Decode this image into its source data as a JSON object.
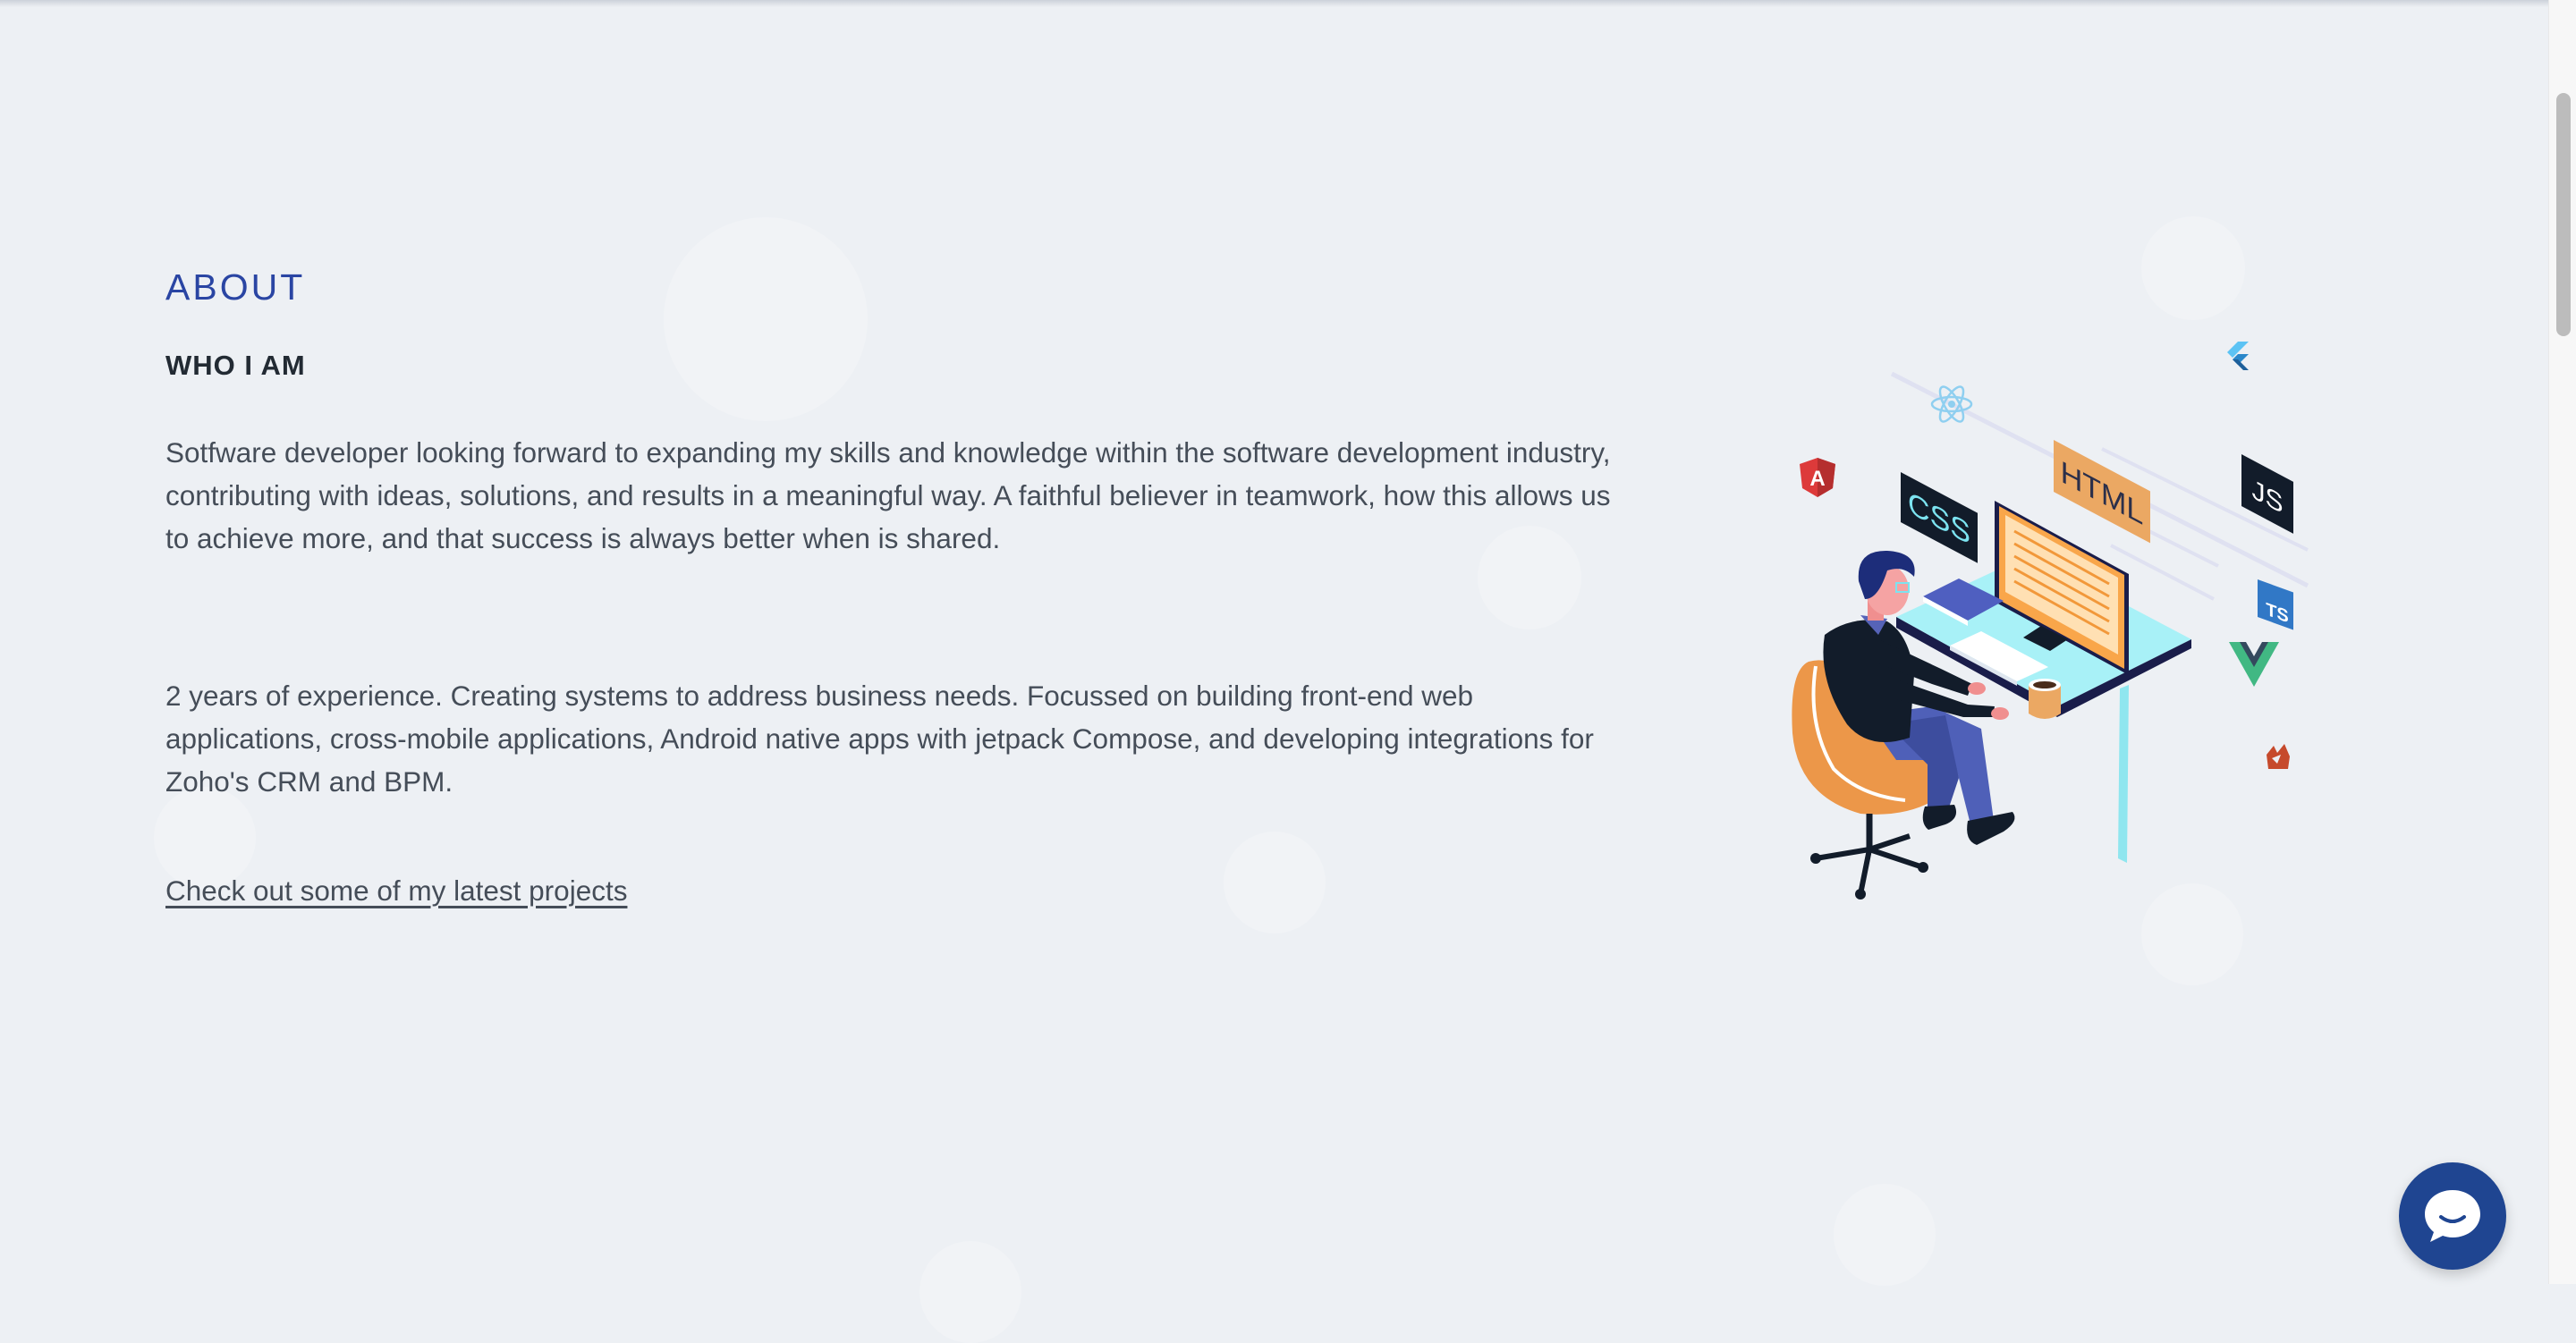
{
  "about": {
    "eyebrow": "ABOUT",
    "subtitle": "WHO I AM",
    "paragraph_1": "Sotfware developer looking forward to expanding my skills and knowledge within the software development industry, contributing with ideas, solutions, and results in a meaningful way. A faithful believer in teamwork, how this allows us to achieve more, and that success is always better when is shared.",
    "paragraph_2": "2 years of experience. Creating systems to address business needs. Focussed on building front-end web applications, cross-mobile applications, Android native apps with jetpack Compose, and developing integrations for Zoho's CRM and BPM.",
    "projects_link": "Check out some of my latest projects"
  },
  "illustration": {
    "labels": {
      "html": "HTML",
      "css": "CSS",
      "js": "JS",
      "ts": "TS",
      "angular": "A"
    },
    "icons": [
      "react-icon",
      "flutter-icon",
      "angular-icon",
      "javascript-icon",
      "typescript-icon",
      "vue-icon",
      "svelte-icon"
    ]
  },
  "chat": {
    "icon": "chat-bubble-icon"
  },
  "colors": {
    "background": "#edf0f4",
    "accent": "#2a45a3",
    "chat_button": "#1f4591",
    "desk": "#a8f1f7",
    "chair": "#ec9749"
  }
}
